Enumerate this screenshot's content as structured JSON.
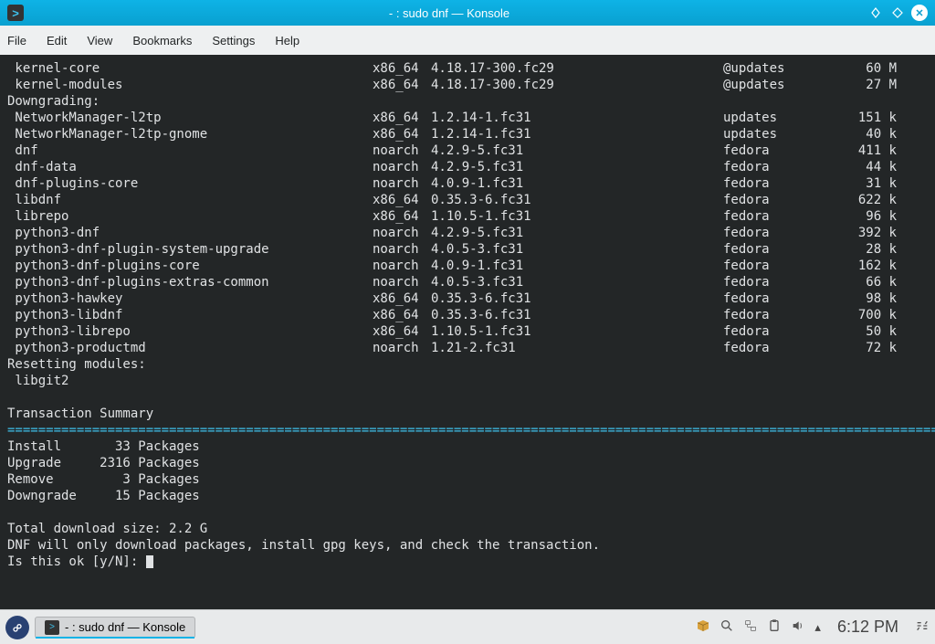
{
  "titlebar": {
    "title": "- : sudo dnf — Konsole"
  },
  "menu": {
    "file": "File",
    "edit": "Edit",
    "view": "View",
    "bookmarks": "Bookmarks",
    "settings": "Settings",
    "help": "Help"
  },
  "upgrade_rows": [
    {
      "pkg": " kernel-core",
      "arch": "x86_64",
      "ver": "4.18.17-300.fc29",
      "repo": "@updates",
      "size": "60 M"
    },
    {
      "pkg": " kernel-modules",
      "arch": "x86_64",
      "ver": "4.18.17-300.fc29",
      "repo": "@updates",
      "size": "27 M"
    }
  ],
  "section_downgrade": "Downgrading:",
  "downgrade_rows": [
    {
      "pkg": " NetworkManager-l2tp",
      "arch": "x86_64",
      "ver": "1.2.14-1.fc31",
      "repo": "updates",
      "size": "151 k"
    },
    {
      "pkg": " NetworkManager-l2tp-gnome",
      "arch": "x86_64",
      "ver": "1.2.14-1.fc31",
      "repo": "updates",
      "size": "40 k"
    },
    {
      "pkg": " dnf",
      "arch": "noarch",
      "ver": "4.2.9-5.fc31",
      "repo": "fedora",
      "size": "411 k"
    },
    {
      "pkg": " dnf-data",
      "arch": "noarch",
      "ver": "4.2.9-5.fc31",
      "repo": "fedora",
      "size": "44 k"
    },
    {
      "pkg": " dnf-plugins-core",
      "arch": "noarch",
      "ver": "4.0.9-1.fc31",
      "repo": "fedora",
      "size": "31 k"
    },
    {
      "pkg": " libdnf",
      "arch": "x86_64",
      "ver": "0.35.3-6.fc31",
      "repo": "fedora",
      "size": "622 k"
    },
    {
      "pkg": " librepo",
      "arch": "x86_64",
      "ver": "1.10.5-1.fc31",
      "repo": "fedora",
      "size": "96 k"
    },
    {
      "pkg": " python3-dnf",
      "arch": "noarch",
      "ver": "4.2.9-5.fc31",
      "repo": "fedora",
      "size": "392 k"
    },
    {
      "pkg": " python3-dnf-plugin-system-upgrade",
      "arch": "noarch",
      "ver": "4.0.5-3.fc31",
      "repo": "fedora",
      "size": "28 k"
    },
    {
      "pkg": " python3-dnf-plugins-core",
      "arch": "noarch",
      "ver": "4.0.9-1.fc31",
      "repo": "fedora",
      "size": "162 k"
    },
    {
      "pkg": " python3-dnf-plugins-extras-common",
      "arch": "noarch",
      "ver": "4.0.5-3.fc31",
      "repo": "fedora",
      "size": "66 k"
    },
    {
      "pkg": " python3-hawkey",
      "arch": "x86_64",
      "ver": "0.35.3-6.fc31",
      "repo": "fedora",
      "size": "98 k"
    },
    {
      "pkg": " python3-libdnf",
      "arch": "x86_64",
      "ver": "0.35.3-6.fc31",
      "repo": "fedora",
      "size": "700 k"
    },
    {
      "pkg": " python3-librepo",
      "arch": "x86_64",
      "ver": "1.10.5-1.fc31",
      "repo": "fedora",
      "size": "50 k"
    },
    {
      "pkg": " python3-productmd",
      "arch": "noarch",
      "ver": "1.21-2.fc31",
      "repo": "fedora",
      "size": "72 k"
    }
  ],
  "section_resetting": "Resetting modules:",
  "resetting_module": " libgit2",
  "summary_title": "Transaction Summary",
  "divider": "================================================================================================================================",
  "summary": [
    "Install       33 Packages",
    "Upgrade     2316 Packages",
    "Remove         3 Packages",
    "Downgrade     15 Packages"
  ],
  "total": "Total download size: 2.2 G",
  "note": "DNF will only download packages, install gpg keys, and check the transaction.",
  "prompt": "Is this ok [y/N]: ",
  "taskbar": {
    "task_label": "- : sudo dnf — Konsole",
    "clock": "6:12 PM"
  }
}
